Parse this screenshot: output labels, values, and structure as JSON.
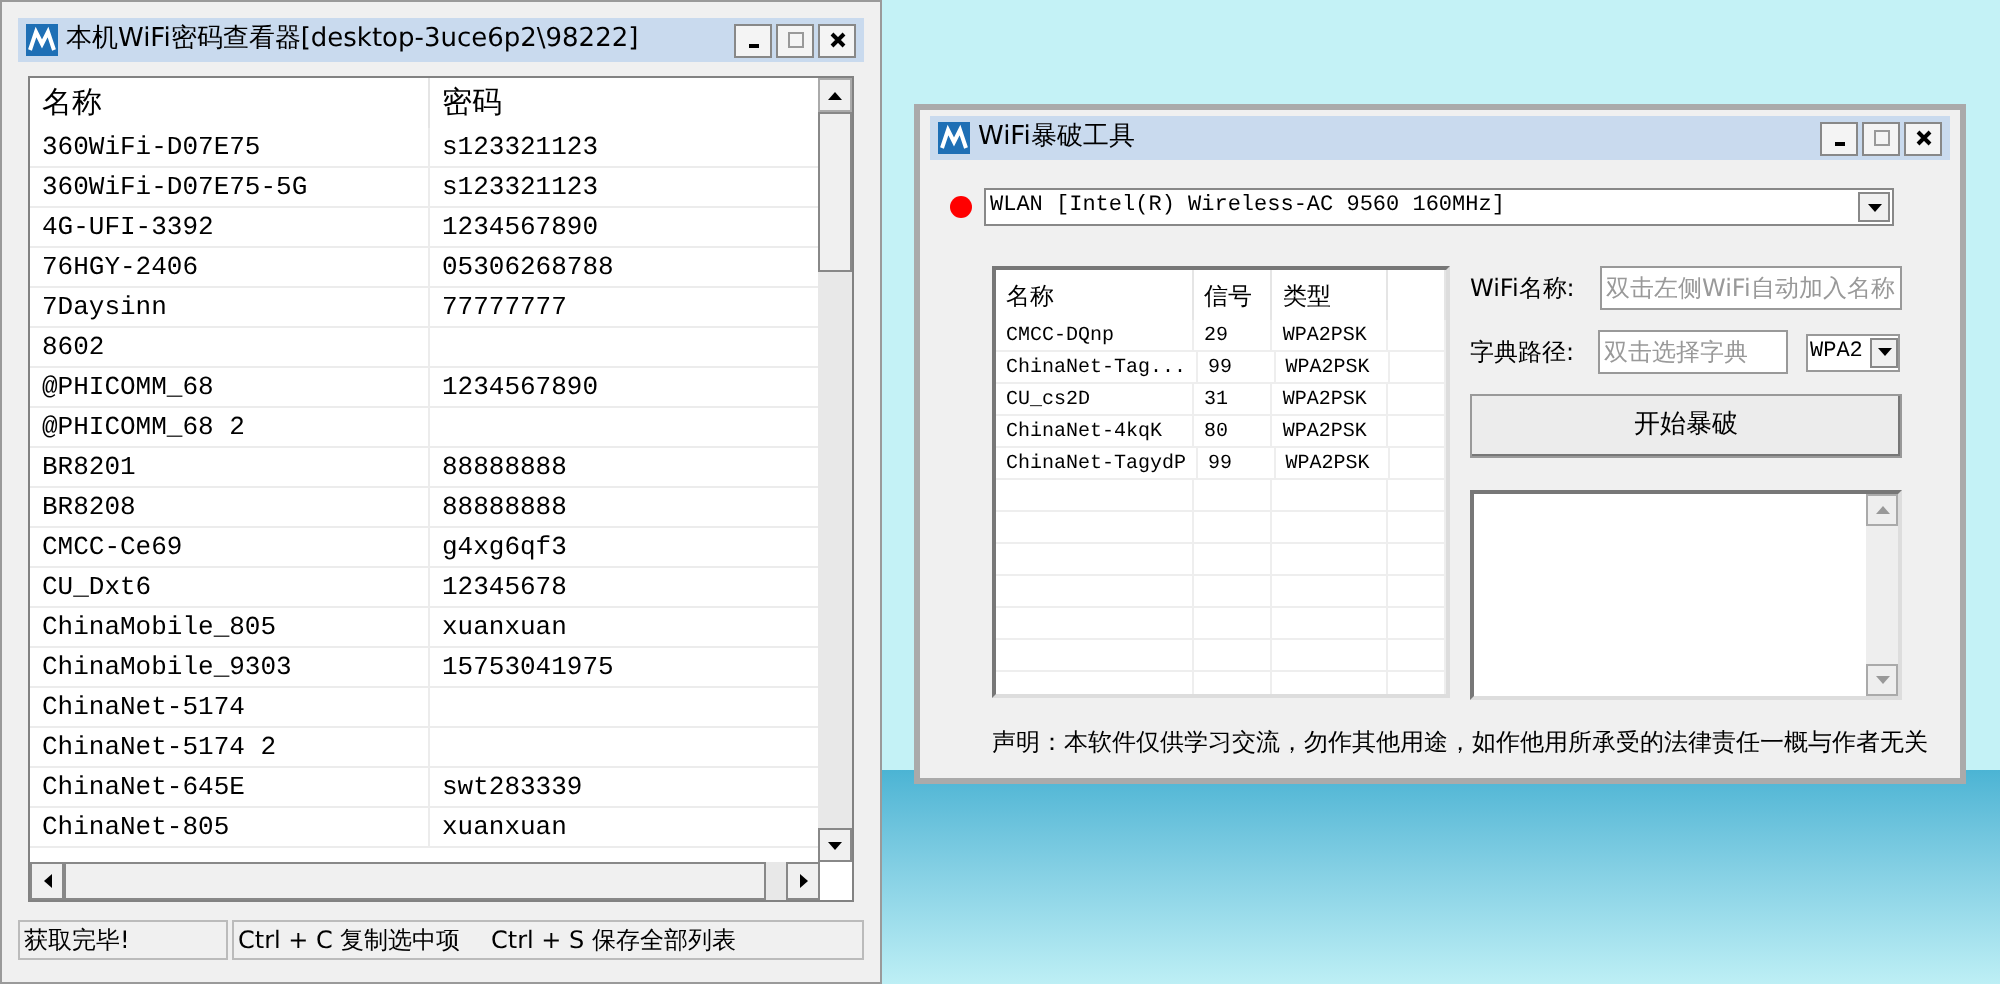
{
  "password_viewer": {
    "title": "本机WiFi密码查看器[desktop-3uce6p2\\98222]",
    "table": {
      "columns": [
        "名称",
        "密码"
      ],
      "rows": [
        [
          "360WiFi-D07E75",
          "s123321123"
        ],
        [
          "360WiFi-D07E75-5G",
          "s123321123"
        ],
        [
          "4G-UFI-3392",
          "1234567890"
        ],
        [
          "76HGY-2406",
          "05306268788"
        ],
        [
          "7Daysinn",
          "77777777"
        ],
        [
          "8602",
          ""
        ],
        [
          "@PHICOMM_68",
          "1234567890"
        ],
        [
          "@PHICOMM_68 2",
          ""
        ],
        [
          "BR8201",
          "88888888"
        ],
        [
          "BR8208",
          "88888888"
        ],
        [
          "CMCC-Ce69",
          "g4xg6qf3"
        ],
        [
          "CU_Dxt6",
          "12345678"
        ],
        [
          "ChinaMobile_805",
          "xuanxuan"
        ],
        [
          "ChinaMobile_9303",
          "15753041975"
        ],
        [
          "ChinaNet-5174",
          ""
        ],
        [
          "ChinaNet-5174 2",
          ""
        ],
        [
          "ChinaNet-645E",
          "swt283339"
        ],
        [
          "ChinaNet-805",
          "xuanxuan"
        ]
      ]
    },
    "status_bar": [
      "获取完毕!",
      "Ctrl + C 复制选中项    Ctrl + S 保存全部列表"
    ]
  },
  "cracker": {
    "title": "WiFi暴破工具",
    "adapter": "WLAN [Intel(R) Wireless-AC 9560 160MHz]",
    "network_list": {
      "columns": [
        "名称",
        "信号",
        "类型"
      ],
      "rows": [
        [
          "CMCC-DQnp",
          "29",
          "WPA2PSK"
        ],
        [
          "ChinaNet-Tag...",
          "99",
          "WPA2PSK"
        ],
        [
          "CU_cs2D",
          "31",
          "WPA2PSK"
        ],
        [
          "ChinaNet-4kqK",
          "80",
          "WPA2PSK"
        ],
        [
          "ChinaNet-TagydP",
          "99",
          "WPA2PSK"
        ]
      ]
    },
    "wifi_name": {
      "label": "WiFi名称:",
      "placeholder": "双击左侧WiFi自动加入名称"
    },
    "dictionary": {
      "label": "字典路径:",
      "placeholder": "双击选择字典",
      "mode": "WPA2"
    },
    "start_button": "开始暴破",
    "disclaimer": "声明：本软件仅供学习交流，勿作其他用途，如作他用所承受的法律责任一概与作者无关"
  }
}
